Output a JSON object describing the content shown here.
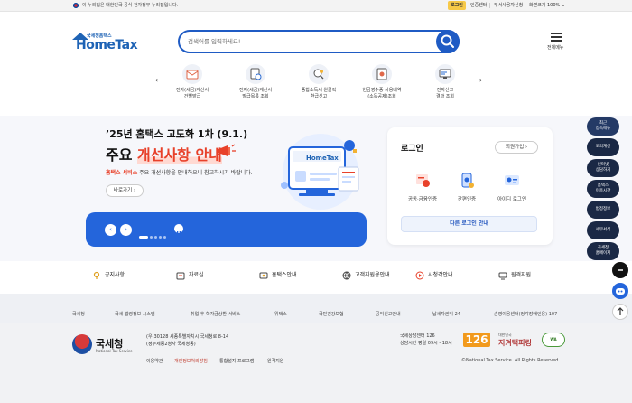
{
  "gov_bar": {
    "notice": "이 누리집은 대한민국 공식 전자정부 누리집입니다.",
    "login": "로그인",
    "cert_center": "인증센터",
    "staff_access": "부서사용자신청",
    "zoom_label": "화면크기",
    "zoom_value": "100%"
  },
  "header": {
    "logo_small": "국세청홈택스",
    "logo_main": "HomeTax",
    "search_placeholder": "검색어를 입력하세요!",
    "menu_label": "전체메뉴"
  },
  "quick_menu": {
    "items": [
      {
        "label": "전자(세금)계산서\n건별발급",
        "icon": "invoice-issue-icon"
      },
      {
        "label": "전자(세금)계산서\n발급목록 조회",
        "icon": "invoice-list-icon"
      },
      {
        "label": "종합소득세 원클릭\n환급신고",
        "icon": "income-tax-refund-icon"
      },
      {
        "label": "현금영수증 사용내역\n(소득공제)조회",
        "icon": "cash-receipt-icon"
      },
      {
        "label": "전자신고\n결과 조회",
        "icon": "e-filing-result-icon"
      }
    ]
  },
  "banner": {
    "title": "’25년 홈택스 고도화 1차 (9.1.)",
    "big_prefix": "주요 ",
    "big_highlight": "개선사항 안내",
    "desc_highlight": "홈택스 서비스",
    "desc_rest": " 주요 개선사항을 안내하오니 참고하시기 바랍니다.",
    "more": "바로가기",
    "screen_logo": "HomeTax"
  },
  "login_card": {
    "title": "로그인",
    "join": "회원가입",
    "options": [
      {
        "label": "공동·금융인증",
        "icon": "certificate-icon"
      },
      {
        "label": "간편인증",
        "icon": "simple-auth-icon"
      },
      {
        "label": "아이디 로그인",
        "icon": "id-login-icon"
      }
    ],
    "other_login": "다른 로그인 안내"
  },
  "links": [
    {
      "label": "공지사항",
      "icon": "megaphone-icon"
    },
    {
      "label": "자료실",
      "icon": "folder-icon"
    },
    {
      "label": "홈택스안내",
      "icon": "guide-icon"
    },
    {
      "label": "고객지원용안내",
      "icon": "headset-icon"
    },
    {
      "label": "시청각안내",
      "icon": "video-icon"
    },
    {
      "label": "원격지원",
      "icon": "remote-icon"
    }
  ],
  "footer_links": [
    "국세청",
    "국세 법령정보 시스템",
    "취업 후 학자금상환 서비스",
    "위택스",
    "국민건강보험",
    "공익신고안내",
    "납세자권익 24",
    "손영이용센터(정각장애인용) 107"
  ],
  "footer": {
    "org_name": "국세청",
    "org_sub": "National Tax Service",
    "address": "(우)30128 세종특별자치시 국세청로 8-14\n(정부세종2청사 국세청동)",
    "center": "국세상담센터 126\n상담시간 평일 09시 - 18시",
    "badge_126": "126",
    "badge_tax_small": "대한민국",
    "badge_tax": "지켜택피킹",
    "badge_cert": "WA",
    "policy": [
      "이용약관",
      "개인정보처리방침",
      "통합설지 프로그램",
      "원격지원"
    ],
    "copyright": "©National Tax Service. All Rights Reserved."
  },
  "side_menu": [
    "최근\n접속메뉴",
    "모의계산",
    "인터넷\n상담하기",
    "홈택스\n이용시간",
    "범정정보",
    "세무서식",
    "국세청\n홈페이지"
  ]
}
